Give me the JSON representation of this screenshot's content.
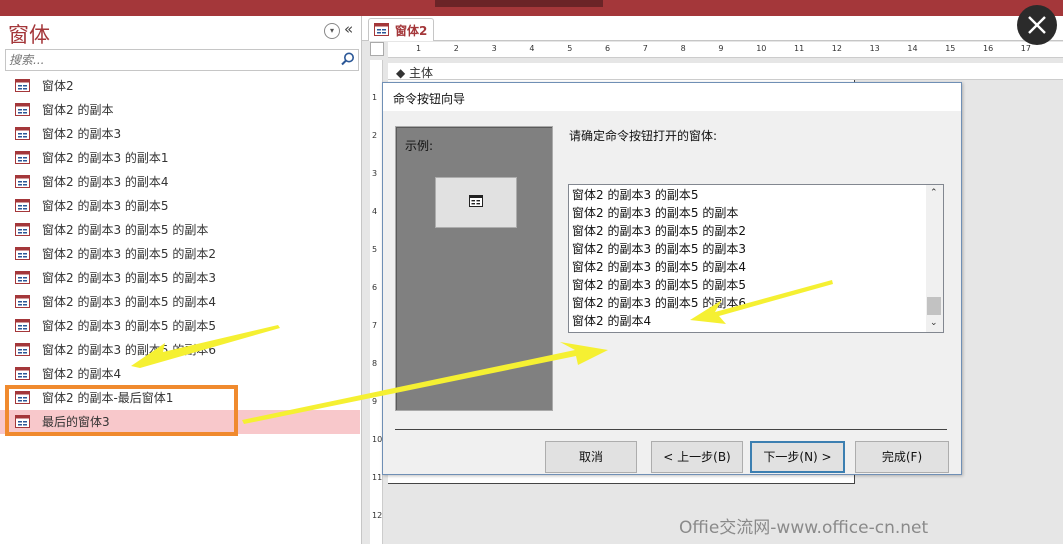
{
  "nav": {
    "title": "窗体",
    "search_placeholder": "搜索...",
    "items": [
      {
        "label": "窗体2"
      },
      {
        "label": "窗体2 的副本"
      },
      {
        "label": "窗体2 的副本3"
      },
      {
        "label": "窗体2 的副本3 的副本1"
      },
      {
        "label": "窗体2 的副本3 的副本4"
      },
      {
        "label": "窗体2 的副本3 的副本5"
      },
      {
        "label": "窗体2 的副本3 的副本5 的副本"
      },
      {
        "label": "窗体2 的副本3 的副本5 的副本2"
      },
      {
        "label": "窗体2 的副本3 的副本5 的副本3"
      },
      {
        "label": "窗体2 的副本3 的副本5 的副本4"
      },
      {
        "label": "窗体2 的副本3 的副本5 的副本5"
      },
      {
        "label": "窗体2 的副本3 的副本5 的副本6"
      },
      {
        "label": "窗体2 的副本4"
      },
      {
        "label": "窗体2 的副本-最后窗体1"
      },
      {
        "label": "最后的窗体3",
        "selected": true
      }
    ]
  },
  "doc": {
    "tab_label": "窗体2",
    "section_label": "主体",
    "h_ruler": [
      "1",
      "2",
      "3",
      "4",
      "5",
      "6",
      "7",
      "8",
      "9",
      "10",
      "11",
      "12",
      "13",
      "14",
      "15",
      "16",
      "17"
    ],
    "v_ruler": [
      "1",
      "2",
      "3",
      "4",
      "5",
      "6",
      "7",
      "8",
      "9",
      "10",
      "11",
      "12"
    ]
  },
  "dialog": {
    "title": "命令按钮向导",
    "sample_label": "示例:",
    "prompt": "请确定命令按钮打开的窗体:",
    "list_items": [
      "窗体2 的副本3 的副本5",
      "窗体2 的副本3 的副本5 的副本",
      "窗体2 的副本3 的副本5 的副本2",
      "窗体2 的副本3 的副本5 的副本3",
      "窗体2 的副本3 的副本5 的副本4",
      "窗体2 的副本3 的副本5 的副本5",
      "窗体2 的副本3 的副本5 的副本6",
      "窗体2 的副本4"
    ],
    "buttons": {
      "cancel": "取消",
      "back": "< 上一步(B)",
      "next": "下一步(N) >",
      "finish": "完成(F)"
    }
  },
  "watermark": "Offie交流网-www.office-cn.net",
  "colors": {
    "accent": "#a4373a",
    "selected_bg": "#f8c8cb",
    "highlight_box": "#f08a2e",
    "arrow": "#f5f032"
  }
}
